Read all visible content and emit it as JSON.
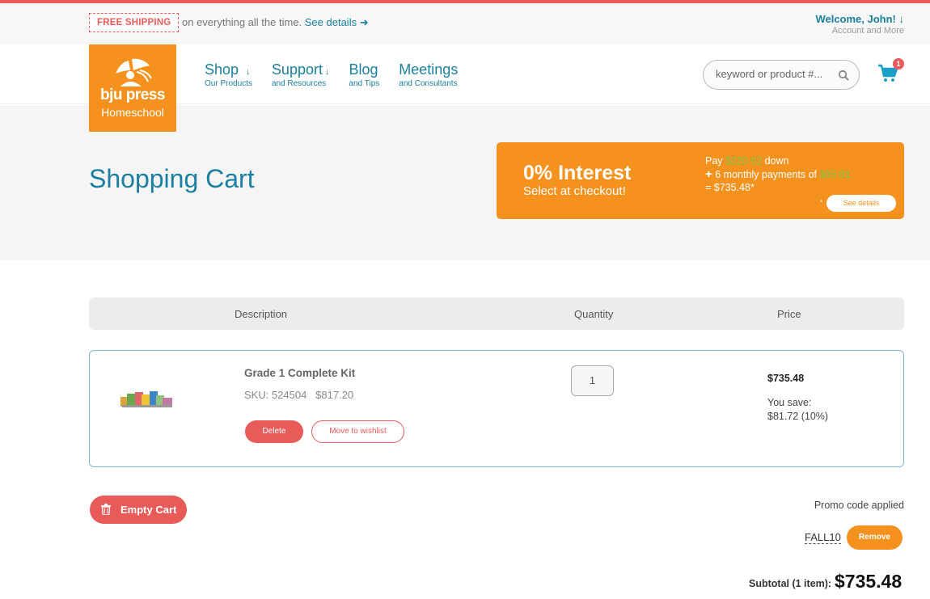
{
  "utility": {
    "free_shipping_badge": "FREE SHIPPING",
    "shipping_text": "on everything all the time.",
    "see_details_link": "See details ➜",
    "welcome": "Welcome, John! ↓",
    "account_more": "Account and More"
  },
  "logo": {
    "word": "bju press",
    "sub": "Homeschool"
  },
  "nav": {
    "items": [
      {
        "label": "Shop",
        "sub": "Our Products",
        "has_arrow": true
      },
      {
        "label": "Support",
        "sub": "and Resources",
        "has_arrow": true
      },
      {
        "label": "Blog",
        "sub": "and Tips",
        "has_arrow": false
      },
      {
        "label": "Meetings",
        "sub": "and Consultants",
        "has_arrow": false
      }
    ],
    "arrow_glyph": "↓"
  },
  "search": {
    "placeholder": "keyword or product #..."
  },
  "cart": {
    "count": "1"
  },
  "hero": {
    "title": "Shopping Cart",
    "promo": {
      "headline": "0% Interest",
      "subhead": "Select at checkout!",
      "pay_prefix": "Pay ",
      "down_amount": "$220.62",
      "down_suffix": " down",
      "plus": "+",
      "monthly_text": " 6 monthly payments of ",
      "monthly_amount": "$85.81",
      "total_line": "= $735.48*",
      "asterisk": "*",
      "see_details": "See details"
    }
  },
  "table": {
    "headers": {
      "description": "Description",
      "quantity": "Quantity",
      "price": "Price"
    }
  },
  "item": {
    "name": "Grade 1 Complete Kit",
    "sku": "SKU: 524504   $817.20",
    "delete": "Delete",
    "wishlist": "Move to wishlist",
    "quantity": "1",
    "price": "$735.48",
    "you_save_label": "You save:",
    "you_save_value": "$81.72 (10%)"
  },
  "actions": {
    "empty_cart": "Empty Cart"
  },
  "promo_code": {
    "applied_label": "Promo code applied",
    "code": "FALL10",
    "remove": "Remove"
  },
  "subtotal": {
    "label": "Subtotal (1 item):",
    "value": "$735.48"
  },
  "colors": {
    "accent_red": "#e95b59",
    "brand_orange": "#f5921e",
    "link_teal": "#1a7fa0",
    "promo_green": "#7fc241"
  }
}
